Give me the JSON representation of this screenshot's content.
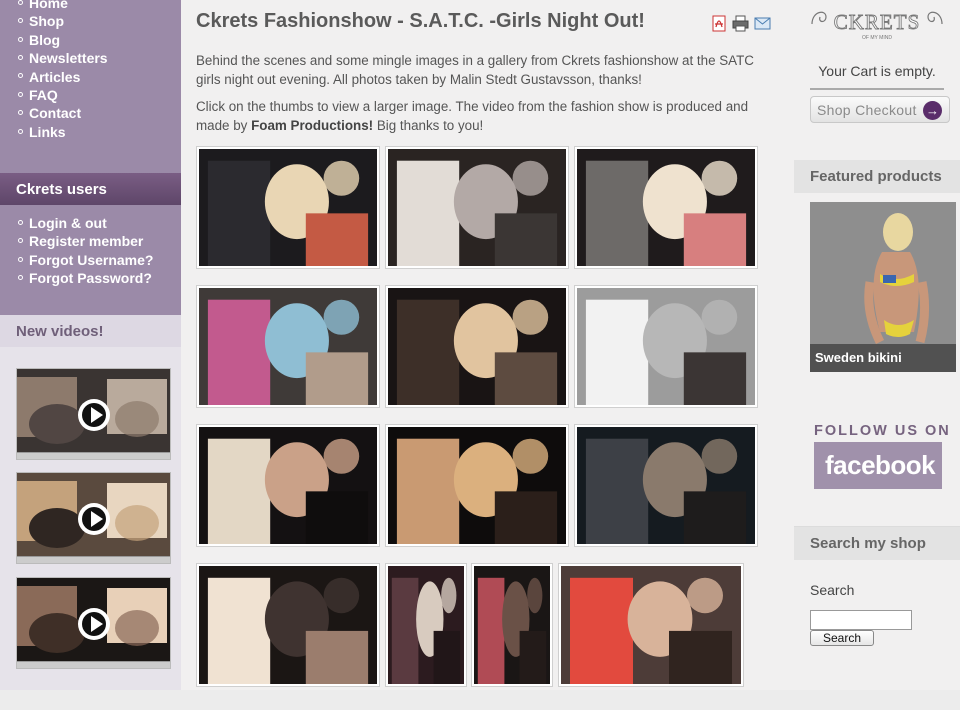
{
  "nav": {
    "main": [
      "Home",
      "Shop",
      "Blog",
      "Newsletters",
      "Articles",
      "FAQ",
      "Contact",
      "Links"
    ],
    "users_title": "Ckrets users",
    "users": [
      "Login & out",
      "Register member",
      "Forgot Username?",
      "Forgot Password?"
    ],
    "videos_title": "New videos!"
  },
  "videos": [
    {
      "colors": [
        "#3a3432",
        "#8d7a6c",
        "#b9aa9c",
        "#514643"
      ]
    },
    {
      "colors": [
        "#5a4a3e",
        "#c4a27c",
        "#e8d6c0",
        "#2f2622"
      ]
    },
    {
      "colors": [
        "#1b1715",
        "#8a6a58",
        "#e8d0b8",
        "#3f2f27"
      ]
    }
  ],
  "article": {
    "title": "Ckrets Fashionshow - S.A.T.C. -Girls Night Out!",
    "paragraph1": "Behind the scenes and some mingle images in a gallery from Ckrets fashionshow at the SATC girls night out evening. All photos taken by Malin Stedt Gustavsson, thanks!",
    "paragraph2_pre": "Click on the thumbs to view a larger image. The video from the fashion show is produced and made by ",
    "paragraph2_bold": "Foam Productions!",
    "paragraph2_post": " Big thanks to you!",
    "icons": [
      "pdf-icon",
      "print-icon",
      "email-icon"
    ]
  },
  "gallery": [
    {
      "colors": [
        "#1c1b1e",
        "#2b2a2f",
        "#e9d6b4",
        "#c45a44"
      ]
    },
    {
      "colors": [
        "#2a2422",
        "#e2dcd6",
        "#b3a9a6",
        "#3b3634"
      ]
    },
    {
      "colors": [
        "#1f1b1c",
        "#6d6a68",
        "#efe2cf",
        "#d77f7f"
      ]
    },
    {
      "colors": [
        "#3f3a38",
        "#c25a8e",
        "#8fbed3",
        "#b19c8b"
      ]
    },
    {
      "colors": [
        "#191414",
        "#3d2f28",
        "#e1c49f",
        "#5d4b40"
      ]
    },
    {
      "colors": [
        "#9c9c9c",
        "#f2f2f2",
        "#b7b7b7",
        "#3b3534"
      ]
    },
    {
      "colors": [
        "#141112",
        "#e3d7c5",
        "#caa188",
        "#0f0d0d"
      ]
    },
    {
      "colors": [
        "#0e0c0c",
        "#c99a72",
        "#dbb07e",
        "#2b1f1a"
      ]
    },
    {
      "colors": [
        "#151b20",
        "#3d4046",
        "#8a7a6c",
        "#1e1c1c"
      ]
    },
    {
      "colors": [
        "#1b1614",
        "#f0e2d2",
        "#3f3330",
        "#9b7d6d"
      ]
    },
    {
      "colors": [
        "#2c1b1f",
        "#5a3a40",
        "#d8cbbf",
        "#211618"
      ]
    },
    {
      "colors": [
        "#1a1615",
        "#b04b55",
        "#6a5147",
        "#231b19"
      ]
    },
    {
      "colors": [
        "#4d3c38",
        "#e24a3e",
        "#d8b39a",
        "#30241f"
      ]
    }
  ],
  "right": {
    "logo": "CKRETS",
    "logo_sub": "OF MY MIND",
    "cart_empty": "Your Cart is empty.",
    "checkout": "Shop Checkout",
    "checkout_arrow": "→",
    "featured_title": "Featured products",
    "featured_caption": "Sweden bikini",
    "follow": "FOLLOW US ON",
    "facebook": "facebook",
    "search_title": "Search my shop",
    "search_label": "Search",
    "search_value": "",
    "search_button": "Search"
  }
}
